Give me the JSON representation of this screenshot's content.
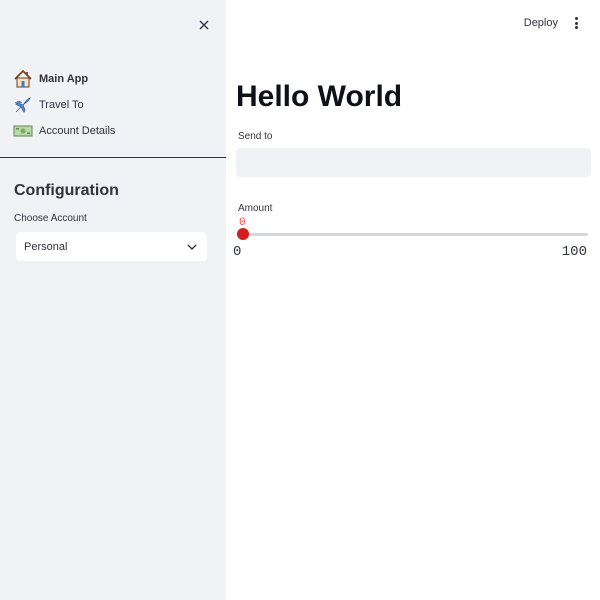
{
  "sidebar": {
    "nav": [
      {
        "label": "Main App",
        "icon": "house-icon",
        "active": true
      },
      {
        "label": "Travel To",
        "icon": "airplane-icon",
        "active": false
      },
      {
        "label": "Account Details",
        "icon": "money-icon",
        "active": false
      }
    ],
    "config_title": "Configuration",
    "choose_label": "Choose Account",
    "select_value": "Personal"
  },
  "header": {
    "deploy_label": "Deploy"
  },
  "main": {
    "title": "Hello World",
    "send_to_label": "Send to",
    "send_to_value": "",
    "amount_label": "Amount",
    "slider": {
      "value": "0",
      "min": "0",
      "max": "100",
      "fraction": 0
    }
  },
  "colors": {
    "accent": "#ff4b4b",
    "sidebar_bg": "#f0f2f6",
    "text": "#31333f"
  }
}
